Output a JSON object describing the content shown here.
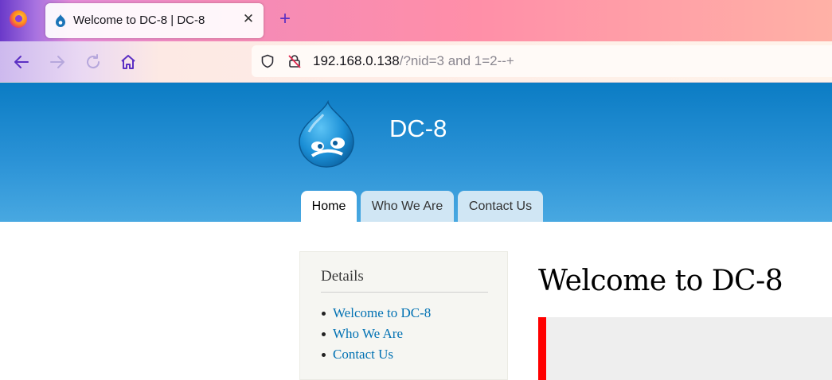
{
  "browser": {
    "tab": {
      "title": "Welcome to DC-8 | DC-8",
      "close_icon": "close-icon"
    },
    "url": {
      "host": "192.168.0.138",
      "path": "/?nid=3 and 1=2--+"
    },
    "icons": [
      "firefox-logo",
      "back-icon",
      "forward-icon",
      "reload-icon",
      "home-icon",
      "shield-icon",
      "insecure-lock-icon",
      "plus-icon"
    ]
  },
  "site": {
    "name": "DC-8",
    "menu": [
      {
        "label": "Home",
        "active": true
      },
      {
        "label": "Who We Are",
        "active": false
      },
      {
        "label": "Contact Us",
        "active": false
      }
    ]
  },
  "sidebar": {
    "title": "Details",
    "links": [
      "Welcome to DC-8",
      "Who We Are",
      "Contact Us"
    ]
  },
  "main": {
    "title": "Welcome to DC-8"
  },
  "colors": {
    "header_top": "#0b7cc4",
    "header_bottom": "#48a8e1",
    "link": "#0071b3",
    "error_border": "#ff0000",
    "browser_accent": "#5b2fc3"
  }
}
